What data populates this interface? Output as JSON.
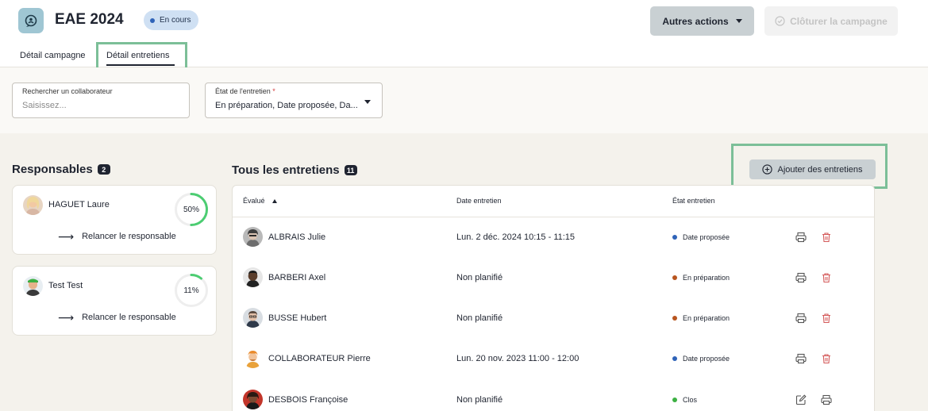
{
  "header": {
    "title": "EAE 2024",
    "status_badge": "En cours",
    "more_actions": "Autres actions",
    "close_campaign": "Clôturer la campagne",
    "tabs": [
      {
        "label": "Détail campagne"
      },
      {
        "label": "Détail entretiens"
      }
    ]
  },
  "filters": {
    "search_label": "Rechercher un collaborateur",
    "search_placeholder": "Saisissez...",
    "state_label": "État de l'entretien",
    "state_required": "*",
    "state_value": "En préparation, Date proposée, Da..."
  },
  "managers": {
    "title": "Responsables",
    "count": "2",
    "items": [
      {
        "name": "HAGUET Laure",
        "progress_label": "50%",
        "progress": 0.5,
        "link": "Relancer le responsable",
        "arrow": "⟶"
      },
      {
        "name": "Test Test",
        "progress_label": "11%",
        "progress": 0.11,
        "link": "Relancer le responsable",
        "arrow": "⟶"
      }
    ]
  },
  "interviews": {
    "title": "Tous les entretiens",
    "count": "11",
    "add_button": "Ajouter des entretiens",
    "columns": {
      "evaluated": "Évalué",
      "date": "Date entretien",
      "state": "État entretien"
    },
    "rows": [
      {
        "name": "ALBRAIS Julie",
        "date": "Lun. 2 déc. 2024 10:15 - 11:15",
        "state": "Date proposée",
        "state_color": "#2f63b8"
      },
      {
        "name": "BARBERI Axel",
        "date": "Non planifié",
        "state": "En préparation",
        "state_color": "#b8551f"
      },
      {
        "name": "BUSSE Hubert",
        "date": "Non planifié",
        "state": "En préparation",
        "state_color": "#b8551f"
      },
      {
        "name": "COLLABORATEUR Pierre",
        "date": "Lun. 20 nov. 2023 11:00 - 12:00",
        "state": "Date proposée",
        "state_color": "#2f63b8"
      },
      {
        "name": "DESBOIS Françoise",
        "date": "Non planifié",
        "state": "Clos",
        "state_color": "#3cb043"
      }
    ]
  },
  "colors": {
    "accent_highlight": "#7cbf98",
    "progress_ring": "#4ccd72",
    "delete_icon": "#d45a5a"
  }
}
